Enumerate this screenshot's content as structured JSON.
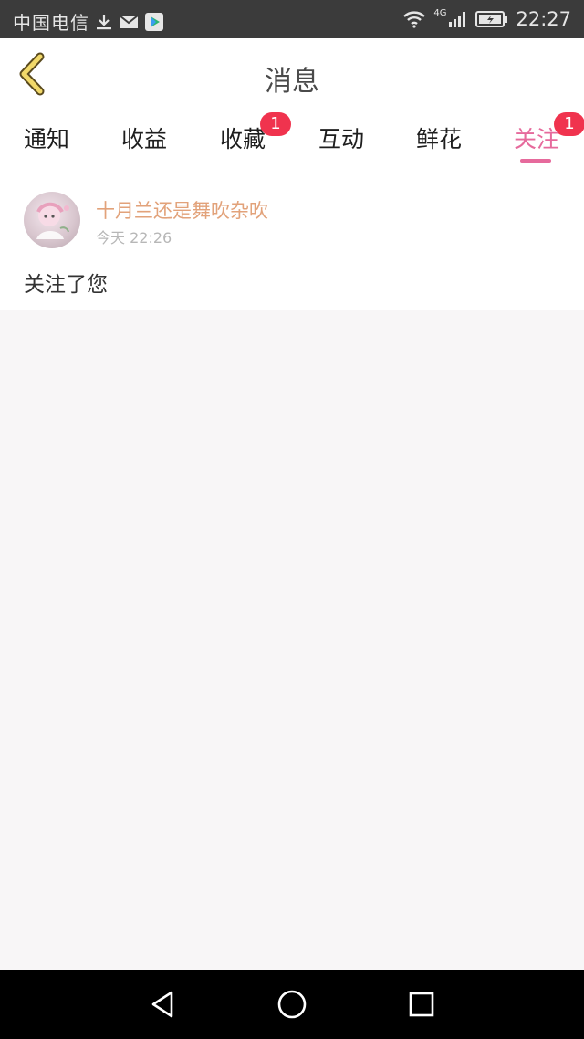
{
  "status_bar": {
    "carrier": "中国电信",
    "network": "4G",
    "time": "22:27",
    "icons": [
      "download-icon",
      "mail-icon",
      "play-store-icon",
      "wifi-icon",
      "signal-icon",
      "battery-icon"
    ]
  },
  "header": {
    "title": "消息",
    "back_icon": "back-arrow-icon"
  },
  "tabs": [
    {
      "label": "通知",
      "badge": ""
    },
    {
      "label": "收益",
      "badge": ""
    },
    {
      "label": "收藏",
      "badge": "1"
    },
    {
      "label": "互动",
      "badge": ""
    },
    {
      "label": "鲜花",
      "badge": ""
    },
    {
      "label": "关注",
      "badge": "1",
      "active": true
    }
  ],
  "message": {
    "sender": "十月兰还是舞吹杂吹",
    "time": "今天 22:26",
    "body": "关注了您"
  },
  "nav_bar": {
    "icons": [
      "back-triangle-icon",
      "home-circle-icon",
      "recents-square-icon"
    ]
  },
  "colors": {
    "accent": "#e66a9c",
    "badge": "#f0334e",
    "sender": "#e2a27a",
    "status_bar": "#3b3b3b"
  }
}
